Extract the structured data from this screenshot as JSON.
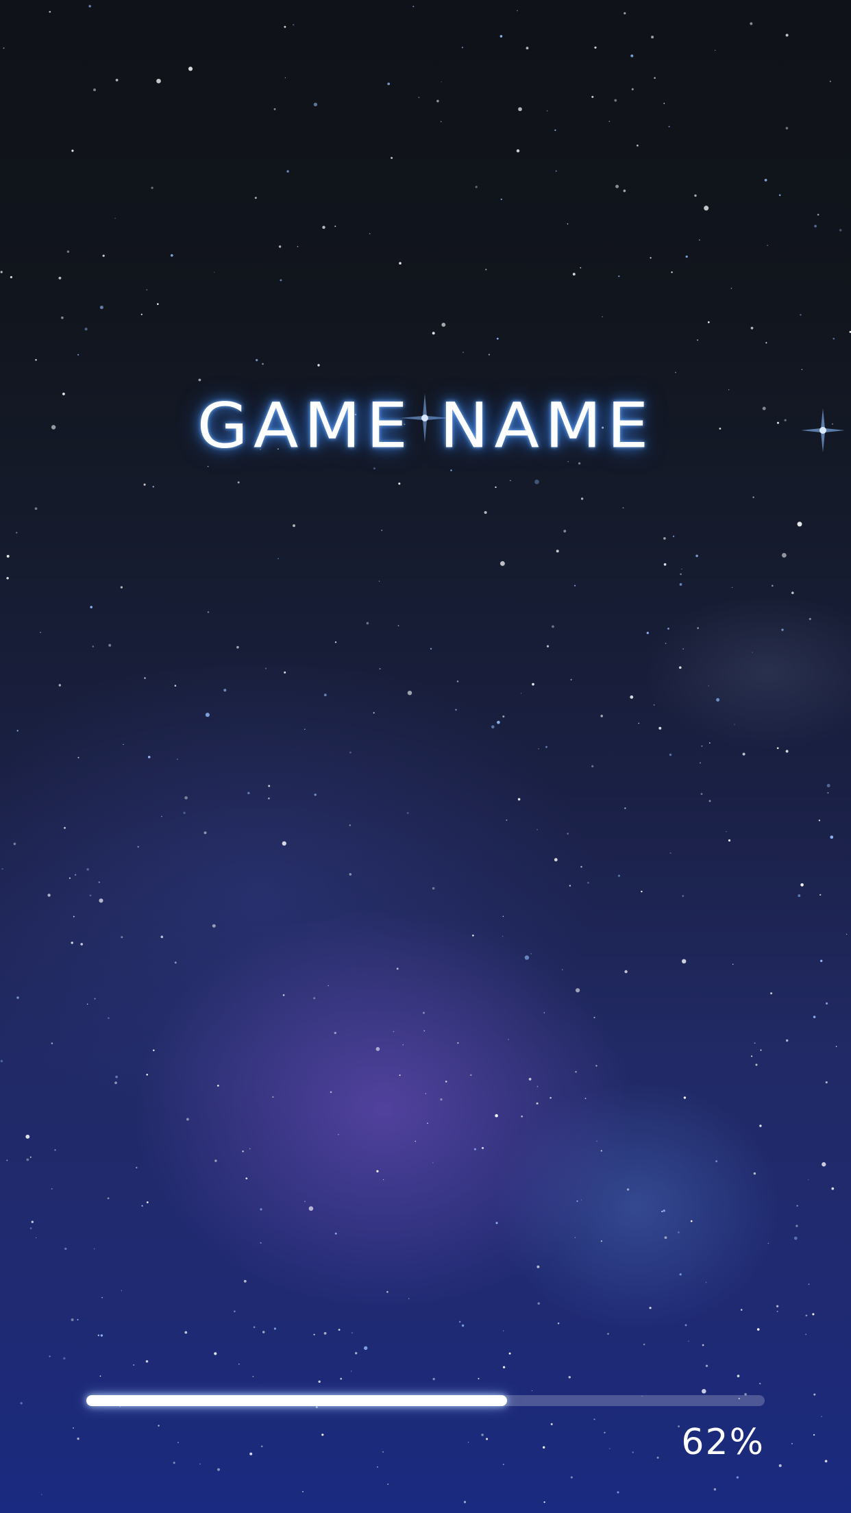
{
  "game": {
    "title": "GAME NAME"
  },
  "loading": {
    "progress": 0.62,
    "progress_label": "62%"
  },
  "colors": {
    "title_glow": "#4a96ff",
    "progress_fill": "#ffffff",
    "progress_track": "rgba(255,255,255,0.22)"
  }
}
